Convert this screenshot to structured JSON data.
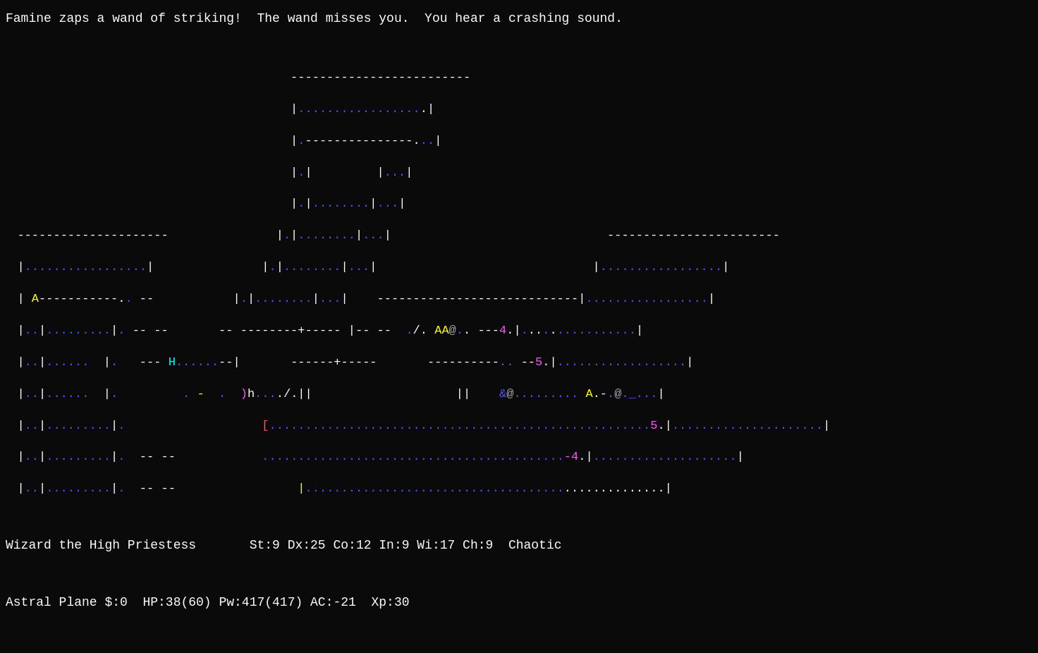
{
  "message": "Famine zaps a wand of striking!  The wand misses you.  You hear a crashing sound.",
  "status1": "Wizard the High Priestess       St:9 Dx:25 Co:12 In:9 Wi:17 Ch:9  Chaotic",
  "status2": "Astral Plane $:0  HP:38(60) Pw:417(417) AC:-21  Xp:30"
}
